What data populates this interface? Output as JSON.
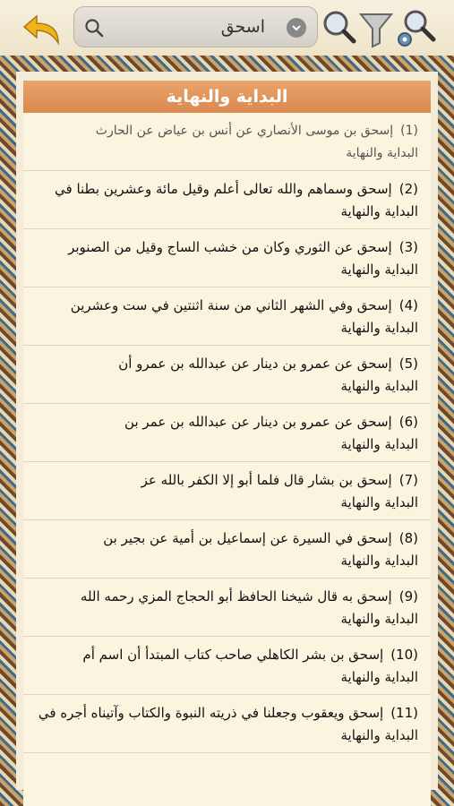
{
  "search": {
    "query": "اسحق"
  },
  "section": {
    "title": "البداية والنهاية"
  },
  "results": [
    {
      "num": "(1)",
      "text": "إسحق بن موسى الأنصاري عن أنس بن عياض عن الحارث",
      "book": "البداية والنهاية"
    },
    {
      "num": "(2)",
      "text": "إسحق وسماهم والله تعالى أعلم وقيل مائة وعشرين بطنا في",
      "book": "البداية والنهاية"
    },
    {
      "num": "(3)",
      "text": "إسحق عن الثوري وكان من خشب الساج وقيل من الصنوبر",
      "book": "البداية والنهاية"
    },
    {
      "num": "(4)",
      "text": "إسحق وفي الشهر الثاني من سنة اثنتين في ست وعشرين",
      "book": "البداية والنهاية"
    },
    {
      "num": "(5)",
      "text": "إسحق عن عمرو بن دينار عن عبدالله بن عمرو أن",
      "book": "البداية والنهاية"
    },
    {
      "num": "(6)",
      "text": "إسحق عن عمرو بن دينار عن عبدالله بن عمر بن",
      "book": "البداية والنهاية"
    },
    {
      "num": "(7)",
      "text": "إسحق بن بشار قال فلما أبو إلا الكفر بالله عز",
      "book": "البداية والنهاية"
    },
    {
      "num": "(8)",
      "text": "إسحق في السيرة عن إسماعيل بن أمية عن بجير بن",
      "book": "البداية والنهاية"
    },
    {
      "num": "(9)",
      "text": "إسحق به قال شيخنا الحافظ أبو الحجاج المزي رحمه الله",
      "book": "البداية والنهاية"
    },
    {
      "num": "(10)",
      "text": "إسحق بن بشر الكاهلي صاحب كتاب المبتدأ أن اسم أم",
      "book": "البداية والنهاية"
    },
    {
      "num": "(11)",
      "text": "إسحق ويعقوب وجعلنا في ذريته النبوة والكتاب وآتيناه أجره في",
      "book": "البداية والنهاية"
    }
  ]
}
